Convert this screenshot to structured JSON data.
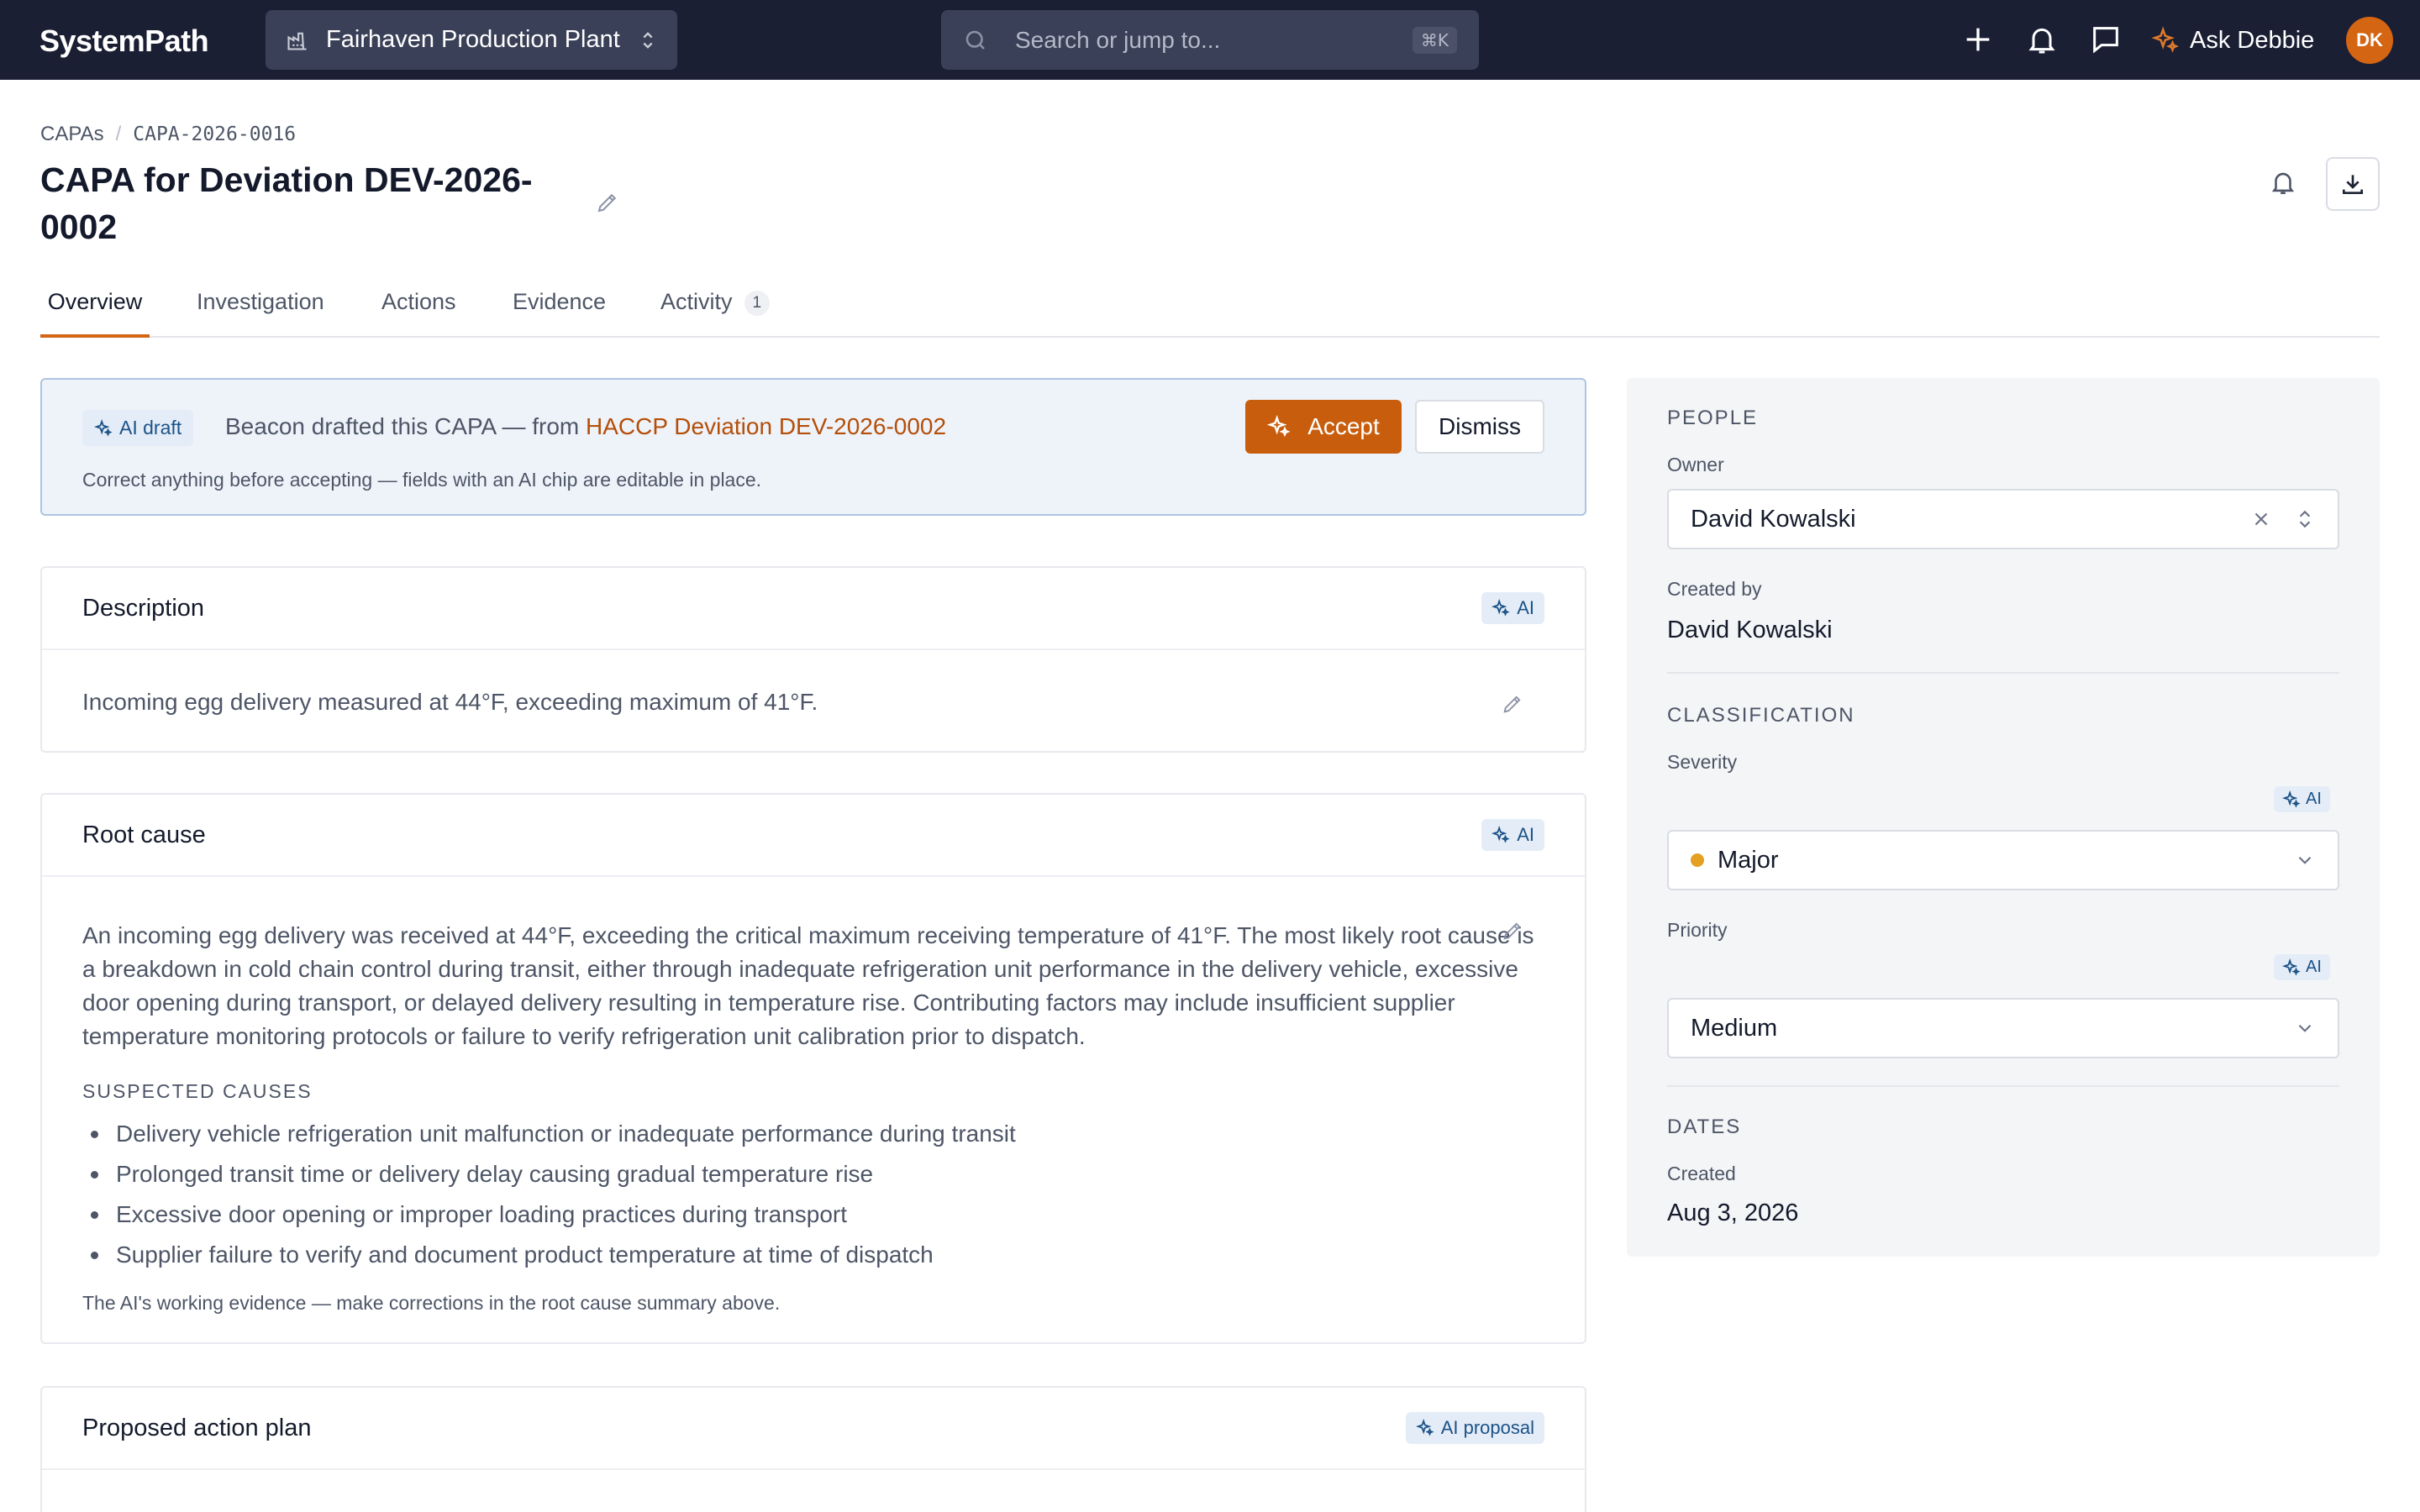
{
  "topbar": {
    "logo": "SystemPath",
    "plant": "Fairhaven Production Plant",
    "search_placeholder": "Search or jump to...",
    "search_shortcut": "⌘K",
    "ask_label": "Ask Debbie",
    "avatar_initials": "DK"
  },
  "breadcrumb": [
    "CAPAs",
    "CAPA-2026-0016"
  ],
  "page": {
    "title": "CAPA for Deviation DEV-2026-0002"
  },
  "tabs": [
    {
      "label": "Overview",
      "active": true
    },
    {
      "label": "Investigation"
    },
    {
      "label": "Actions"
    },
    {
      "label": "Evidence"
    },
    {
      "label": "Activity",
      "badge": "1"
    }
  ],
  "ai_banner": {
    "chip": "AI draft",
    "text": "Beacon drafted this CAPA — from ",
    "link": "HACCP Deviation DEV-2026-0002",
    "sub": "Correct anything before accepting — fields with an AI chip are editable in place.",
    "accept": "Accept",
    "dismiss": "Dismiss"
  },
  "description": {
    "title": "Description",
    "chip": "AI",
    "text": "Incoming egg delivery measured at 44°F, exceeding maximum of 41°F."
  },
  "root_cause": {
    "title": "Root cause",
    "chip": "AI",
    "text": "An incoming egg delivery was received at 44°F, exceeding the critical maximum receiving temperature of 41°F. The most likely root cause is a breakdown in cold chain control during transit, either through inadequate refrigeration unit performance in the delivery vehicle, excessive door opening during transport, or delayed delivery resulting in temperature rise. Contributing factors may include insufficient supplier temperature monitoring protocols or failure to verify refrigeration unit calibration prior to dispatch.",
    "suspected_label": "SUSPECTED CAUSES",
    "causes": [
      "Delivery vehicle refrigeration unit malfunction or inadequate performance during transit",
      "Prolonged transit time or delivery delay causing gradual temperature rise",
      "Excessive door opening or improper loading practices during transport",
      "Supplier failure to verify and document product temperature at time of dispatch"
    ],
    "note": "The AI's working evidence — make corrections in the root cause summary above."
  },
  "action_plan": {
    "title": "Proposed action plan",
    "chip": "AI proposal"
  },
  "side": {
    "people_heading": "PEOPLE",
    "owner_label": "Owner",
    "owner_value": "David Kowalski",
    "created_by_label": "Created by",
    "created_by_value": "David Kowalski",
    "classification_heading": "CLASSIFICATION",
    "severity_label": "Severity",
    "severity_value": "Major",
    "severity_color": "#e3a023",
    "priority_label": "Priority",
    "priority_value": "Medium",
    "ai_chip": "AI",
    "dates_heading": "DATES",
    "created_label": "Created",
    "created_value": "Aug 3, 2026"
  },
  "colors": {
    "topbar": "#1b1f34",
    "accent": "#d46512",
    "ai_chip_bg": "#e4edf7",
    "ai_chip_text": "#1c5288"
  }
}
